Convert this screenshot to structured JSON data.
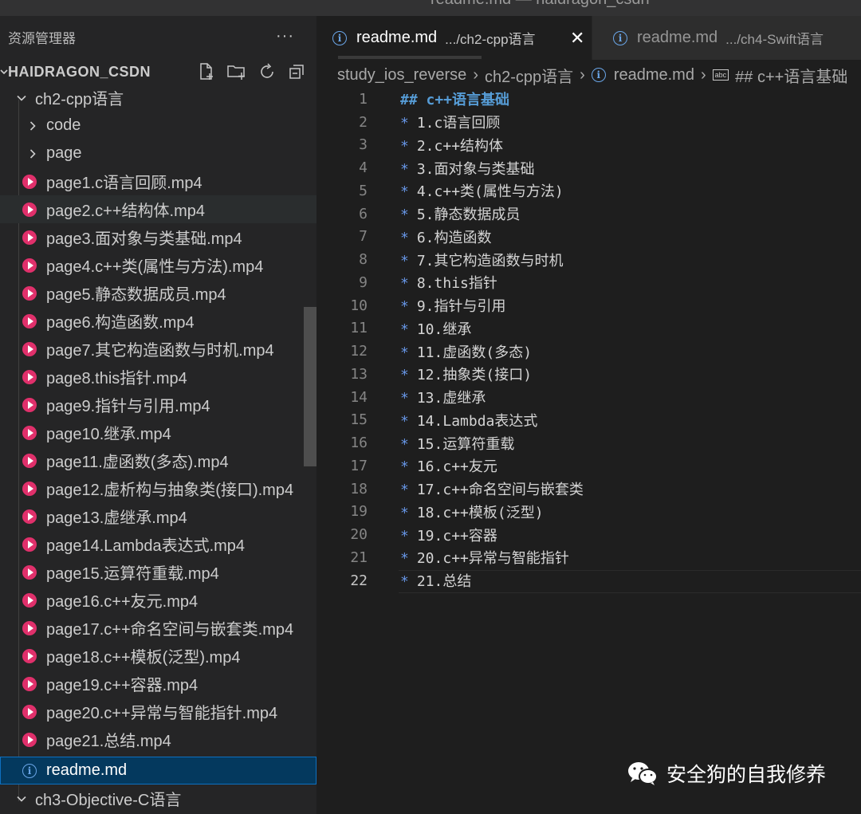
{
  "window": {
    "title": "readme.md — haidragon_csdn"
  },
  "sidebar": {
    "title": "资源管理器",
    "more": "···",
    "root": "HAIDRAGON_CSDN",
    "open_folder": "ch2-cpp语言",
    "folders": [
      "code",
      "page"
    ],
    "files": [
      "page1.c语言回顾.mp4",
      "page2.c++结构体.mp4",
      "page3.面对象与类基础.mp4",
      "page4.c++类(属性与方法).mp4",
      "page5.静态数据成员.mp4",
      "page6.构造函数.mp4",
      "page7.其它构造函数与时机.mp4",
      "page8.this指针.mp4",
      "page9.指针与引用.mp4",
      "page10.继承.mp4",
      "page11.虚函数(多态).mp4",
      "page12.虚析构与抽象类(接口).mp4",
      "page13.虚继承.mp4",
      "page14.Lambda表达式.mp4",
      "page15.运算符重载.mp4",
      "page16.c++友元.mp4",
      "page17.c++命名空间与嵌套类.mp4",
      "page18.c++模板(泛型).mp4",
      "page19.c++容器.mp4",
      "page20.c++异常与智能指针.mp4",
      "page21.总结.mp4"
    ],
    "selected_file": "readme.md",
    "next_folder": "ch3-Objective-C语言"
  },
  "tabs": [
    {
      "name": "readme.md",
      "path": ".../ch2-cpp语言",
      "close": "✕"
    },
    {
      "name": "readme.md",
      "path": ".../ch4-Swift语言"
    }
  ],
  "breadcrumb": [
    "study_ios_reverse",
    "ch2-cpp语言",
    "readme.md",
    "## c++语言基础"
  ],
  "editor": {
    "current_line": 22,
    "lines": [
      {
        "n": "1",
        "text": "## c++语言基础"
      },
      {
        "n": "2",
        "text": "1.c语言回顾"
      },
      {
        "n": "3",
        "text": "2.c++结构体"
      },
      {
        "n": "4",
        "text": "3.面对象与类基础"
      },
      {
        "n": "5",
        "text": "4.c++类(属性与方法)"
      },
      {
        "n": "6",
        "text": "5.静态数据成员"
      },
      {
        "n": "7",
        "text": "6.构造函数"
      },
      {
        "n": "8",
        "text": "7.其它构造函数与时机"
      },
      {
        "n": "9",
        "text": "8.this指针"
      },
      {
        "n": "10",
        "text": "9.指针与引用"
      },
      {
        "n": "11",
        "text": "10.继承"
      },
      {
        "n": "12",
        "text": "11.虚函数(多态)"
      },
      {
        "n": "13",
        "text": "12.抽象类(接口)"
      },
      {
        "n": "14",
        "text": "13.虚继承"
      },
      {
        "n": "15",
        "text": "14.Lambda表达式"
      },
      {
        "n": "16",
        "text": "15.运算符重载"
      },
      {
        "n": "17",
        "text": "16.c++友元"
      },
      {
        "n": "18",
        "text": "17.c++命名空间与嵌套类"
      },
      {
        "n": "19",
        "text": "18.c++模板(泛型)"
      },
      {
        "n": "20",
        "text": "19.c++容器"
      },
      {
        "n": "21",
        "text": "20.c++异常与智能指针"
      },
      {
        "n": "22",
        "text": "21.总结"
      }
    ],
    "bullet": "*"
  },
  "watermark": {
    "text": "安全狗的自我修养"
  },
  "colors": {
    "accent": "#0e70c0",
    "video_icon": "#e0306b",
    "info_icon": "#6aa6e8",
    "heading": "#569cd6"
  }
}
